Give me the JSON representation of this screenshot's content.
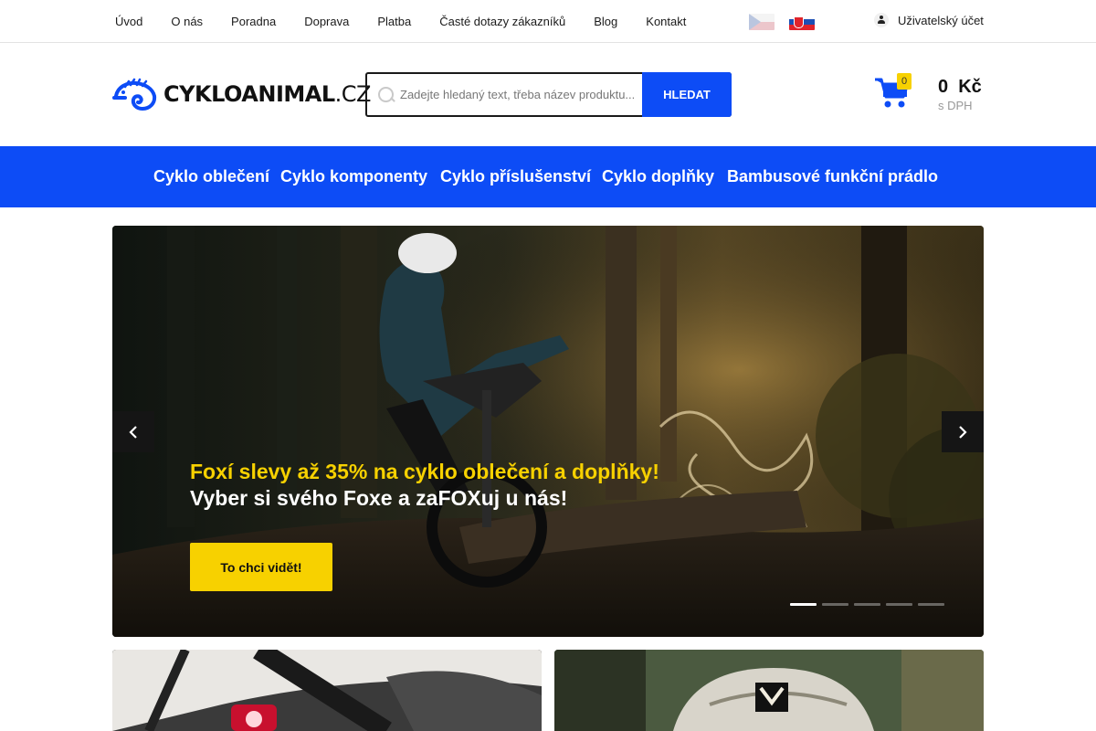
{
  "topnav": {
    "items": [
      "Úvod",
      "O nás",
      "Poradna",
      "Doprava",
      "Platba",
      "Časté dotazy zákazníků",
      "Blog",
      "Kontakt"
    ],
    "account_label": "Uživatelský účet"
  },
  "header": {
    "logo_main": "CYKLOANIMAL",
    "logo_tld": ".CZ",
    "search_placeholder": "Zadejte hledaný text, třeba název produktu...",
    "search_button": "HLEDAT",
    "cart_count": "0",
    "cart_price": "0  Kč",
    "cart_vat": "s DPH",
    "colors": {
      "brand": "#0d4cf6",
      "accent": "#f7d100"
    }
  },
  "categories": [
    "Cyklo oblečení",
    "Cyklo komponenty",
    "Cyklo příslušenství",
    "Cyklo doplňky",
    "Bambusové funkční prádlo"
  ],
  "hero": {
    "headline": "Foxí slevy až 35% na cyklo oblečení a doplňky!",
    "subline": "Vyber si svého Foxe a zaFOXuj u nás!",
    "cta": "To chci vidět!",
    "slides_total": 5,
    "active_slide": 1
  }
}
